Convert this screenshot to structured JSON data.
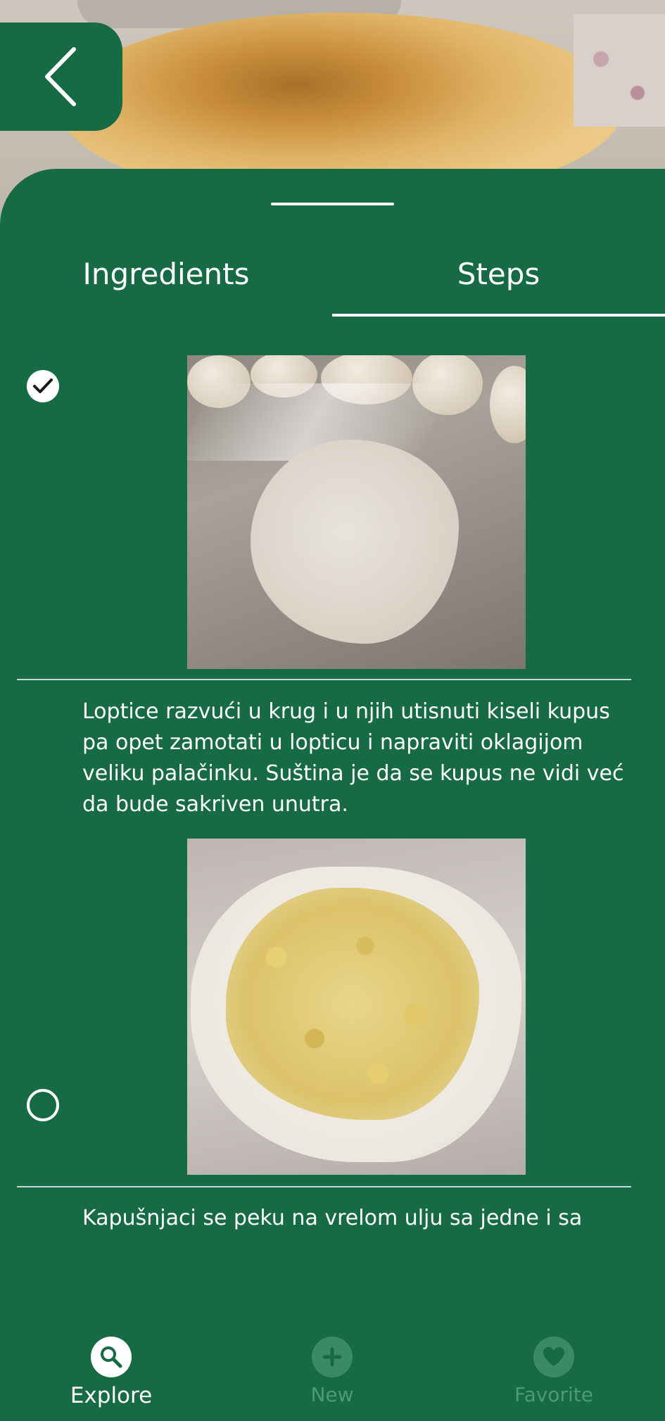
{
  "tabs": {
    "ingredients_label": "Ingredients",
    "steps_label": "Steps",
    "active": "Steps"
  },
  "steps": [
    {
      "checked": true,
      "text": ""
    },
    {
      "checked": false,
      "text": "Loptice razvući u krug i u njih utisnuti kiseli kupus pa opet zamotati u lopticu i napraviti oklagijom veliku palačinku. Suština je da se kupus ne vidi već da bude sakriven unutra."
    },
    {
      "checked": false,
      "text": "Kapušnjaci se peku na vrelom ulju sa jedne i sa"
    }
  ],
  "bottom_nav": {
    "explore_label": "Explore",
    "new_label": "New",
    "favorite_label": "Favorite",
    "active": "Explore"
  },
  "colors": {
    "brand_green": "#166a44",
    "inactive_nav": "#4d9a75"
  },
  "icons": {
    "back": "chevron-left-icon",
    "step_done": "check-circle-icon",
    "step_todo": "empty-circle-icon",
    "explore": "search-icon",
    "new": "plus-icon",
    "favorite": "heart-icon"
  }
}
